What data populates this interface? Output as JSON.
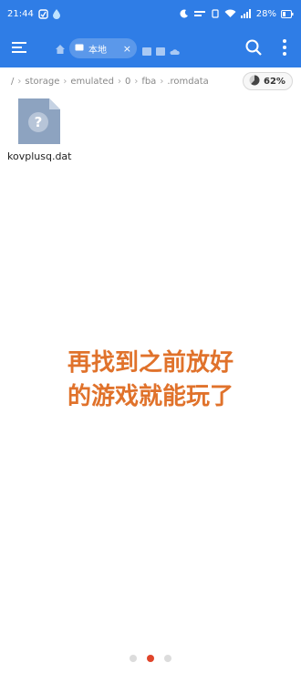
{
  "status": {
    "time": "21:44",
    "battery": "28%"
  },
  "toolbar": {
    "tab_label": "本地",
    "tab_close": "×"
  },
  "breadcrumb": {
    "root": "/",
    "segments": [
      "storage",
      "emulated",
      "0",
      "fba",
      ".romdata"
    ]
  },
  "storage": {
    "percent": "62%",
    "fill": 0.62
  },
  "files": [
    {
      "name": "kovplusq.dat",
      "icon": "unknown-file-icon"
    }
  ],
  "caption": {
    "line1": "再找到之前放好",
    "line2": "的游戏就能玩了"
  },
  "pager": {
    "count": 3,
    "active": 1
  },
  "colors": {
    "accent": "#2f7de6",
    "caption": "#e0722b",
    "dot_active": "#e0452b"
  }
}
